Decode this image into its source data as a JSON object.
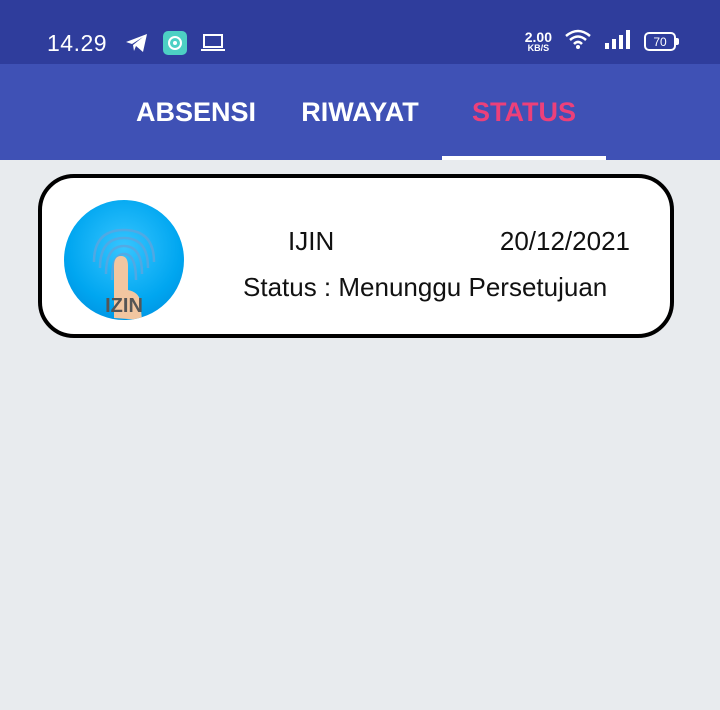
{
  "statusbar": {
    "time": "14.29",
    "net_speed_value": "2.00",
    "net_speed_unit": "KB/S",
    "battery": "70",
    "icons": [
      "telegram-icon",
      "app-icon",
      "laptop-icon",
      "wifi-icon",
      "signal-icon",
      "battery-icon"
    ]
  },
  "tabs": [
    {
      "label": "ABSENSI"
    },
    {
      "label": "RIWAYAT"
    },
    {
      "label": "STATUS"
    }
  ],
  "active_tab": "STATUS",
  "card": {
    "type": "IJIN",
    "date": "20/12/2021",
    "status": "Status : Menunggu Persetujuan",
    "avatar_text": "IZIN"
  },
  "colors": {
    "statusbar_bg": "#2f3d9c",
    "tabbar_bg": "#3f51b5",
    "active_tab": "#ec407a",
    "page_bg": "#e8ebee"
  }
}
